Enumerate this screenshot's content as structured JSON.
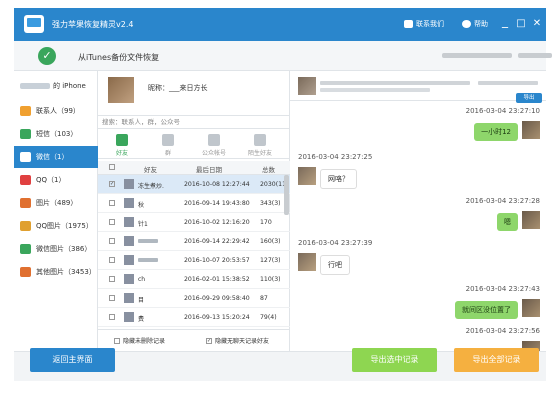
{
  "app": {
    "title": "强力苹果恢复精灵v2.4"
  },
  "titlebar": {
    "contact": "联系我们",
    "help": "帮助",
    "minimize": "_",
    "maximize": "□",
    "close": "✕"
  },
  "subheader": {
    "label": "从iTunes备份文件恢复"
  },
  "sidebar": {
    "device": "的 iPhone",
    "items": [
      {
        "label": "联系人（99）",
        "icon": "contacts-icon",
        "color": "#f0a030"
      },
      {
        "label": "短信（103）",
        "icon": "sms-icon",
        "color": "#3aa65c"
      },
      {
        "label": "微信（1）",
        "icon": "wechat-icon",
        "color": "#3aa65c"
      },
      {
        "label": "QQ（1）",
        "icon": "qq-icon",
        "color": "#e04040"
      },
      {
        "label": "图片（489）",
        "icon": "photos-icon",
        "color": "#e07030"
      },
      {
        "label": "QQ图片（1975）",
        "icon": "qq-photos-icon",
        "color": "#e0a030"
      },
      {
        "label": "微信图片（386）",
        "icon": "wechat-photos-icon",
        "color": "#3aa65c"
      },
      {
        "label": "其他图片（3453）",
        "icon": "other-photos-icon",
        "color": "#e07030"
      }
    ]
  },
  "profile": {
    "name": "昵称：___来日方长"
  },
  "search": {
    "placeholder": "搜索：联系人，群，公众号"
  },
  "tabs": [
    {
      "label": "好友",
      "icon": "friend-icon"
    },
    {
      "label": "群",
      "icon": "group-icon"
    },
    {
      "label": "公众帐号",
      "icon": "official-account-icon"
    },
    {
      "label": "陌生好友",
      "icon": "stranger-icon"
    }
  ],
  "table": {
    "headers": [
      "好友",
      "最后日期",
      "总数"
    ],
    "rows": [
      {
        "name": "冻生煮炒.",
        "date": "2016-10-08 12:27:44",
        "count": "2030(11)",
        "selected": true
      },
      {
        "name": "秋",
        "date": "2016-09-14 19:43:80",
        "count": "343(3)",
        "selected": false
      },
      {
        "name": "针1",
        "date": "2016-10-02 12:16:20",
        "count": "170",
        "selected": false
      },
      {
        "name": "",
        "date": "2016-09-14 22:29:42",
        "count": "160(3)",
        "selected": false
      },
      {
        "name": "",
        "date": "2016-10-07 20:53:57",
        "count": "127(3)",
        "selected": false
      },
      {
        "name": "ch",
        "date": "2016-02-01 15:38:52",
        "count": "110(3)",
        "selected": false
      },
      {
        "name": "目",
        "date": "2016-09-29 09:58:40",
        "count": "87",
        "selected": false
      },
      {
        "name": "费",
        "date": "2016-09-13 15:20:24",
        "count": "79(4)",
        "selected": false
      }
    ]
  },
  "options": {
    "hide_deleted": "隐藏未删除记录",
    "hide_no_chat": "隐藏无聊天记录好友"
  },
  "chat": {
    "header_btn": "导出",
    "messages": [
      {
        "side": "me",
        "time": "2016-03-04 23:27:10",
        "text": "一小时12"
      },
      {
        "side": "them",
        "time": "2016-03-04 23:27:25",
        "text": "网咯？"
      },
      {
        "side": "me",
        "time": "2016-03-04 23:27:28",
        "text": "嗯"
      },
      {
        "side": "them",
        "time": "2016-03-04 23:27:39",
        "text": "行吧"
      },
      {
        "side": "me",
        "time": "2016-03-04 23:27:43",
        "text": "就间区没位置了"
      },
      {
        "side": "me",
        "time": "2016-03-04 23:27:56",
        "text": ""
      }
    ]
  },
  "footer": {
    "back": "返回主界面",
    "export_selected": "导出选中记录",
    "export_all": "导出全部记录"
  }
}
